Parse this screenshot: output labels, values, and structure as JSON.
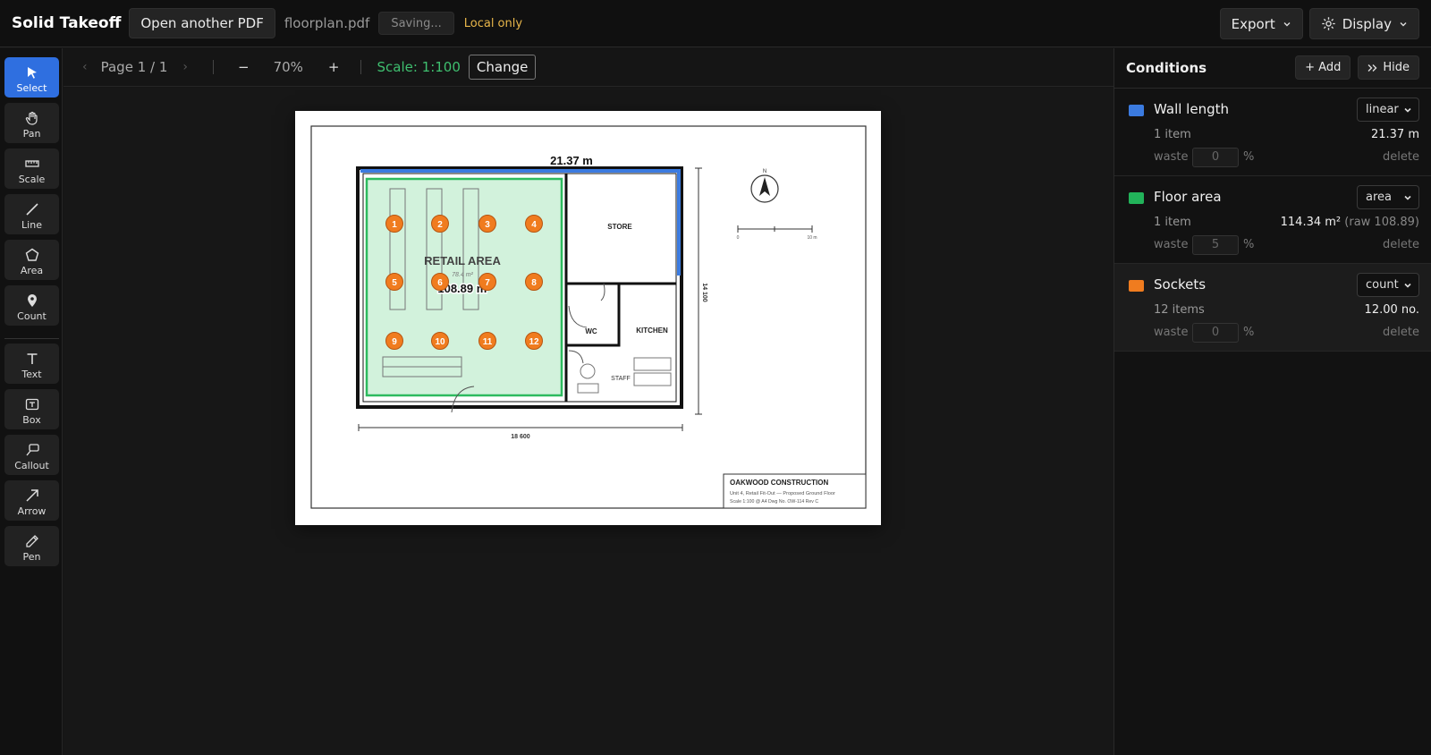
{
  "app": {
    "brand": "Solid Takeoff",
    "open_another": "Open another PDF",
    "filename": "floorplan.pdf",
    "saving": "Saving...",
    "local_only": "Local only",
    "export": "Export",
    "display": "Display"
  },
  "tools": [
    {
      "label": "Select",
      "icon": "cursor-icon",
      "active": true
    },
    {
      "label": "Pan",
      "icon": "hand-icon"
    },
    {
      "label": "Scale",
      "icon": "ruler-icon"
    },
    {
      "label": "Line",
      "icon": "line-icon"
    },
    {
      "label": "Area",
      "icon": "pentagon-icon"
    },
    {
      "label": "Count",
      "icon": "pin-icon"
    },
    {
      "label": "Text",
      "icon": "text-icon"
    },
    {
      "label": "Box",
      "icon": "textbox-icon"
    },
    {
      "label": "Callout",
      "icon": "callout-icon"
    },
    {
      "label": "Arrow",
      "icon": "arrow-icon"
    },
    {
      "label": "Pen",
      "icon": "pen-icon"
    }
  ],
  "viewbar": {
    "page": "Page 1 / 1",
    "zoom": "70%",
    "zoom_out": "−",
    "zoom_in": "+",
    "scale": "Scale: 1:100",
    "change": "Change"
  },
  "drawing": {
    "wall_measure": "21.37 m",
    "area_measure": "108.89 m²",
    "area_label": "RETAIL AREA",
    "area_sub": "78.4 m²",
    "rooms": [
      "STORE",
      "WC",
      "KITCHEN",
      "STAFF"
    ],
    "dim_bottom": "18 600",
    "dim_side": "14 100",
    "scale_bar": [
      "0",
      "10 m"
    ],
    "north": "N",
    "titleblock": {
      "company": "OAKWOOD CONSTRUCTION",
      "line1": "Unit 4, Retail Fit-Out — Proposed Ground Floor",
      "line2": "Scale 1:100 @ A4   Dwg No. OW-114   Rev C"
    },
    "counts": [
      "1",
      "2",
      "3",
      "4",
      "5",
      "6",
      "7",
      "8",
      "9",
      "10",
      "11",
      "12"
    ]
  },
  "conditions": {
    "title": "Conditions",
    "add": "+ Add",
    "hide": "Hide",
    "items": [
      {
        "name": "Wall length",
        "color": "#3b7be0",
        "type": "linear",
        "items": "1 item",
        "value": "21.37 m",
        "raw": "",
        "waste_label": "waste",
        "waste": "0",
        "pct": "%",
        "delete": "delete"
      },
      {
        "name": "Floor area",
        "color": "#22b35a",
        "type": "area",
        "items": "1 item",
        "value": "114.34 m²",
        "raw": "(raw 108.89)",
        "waste_label": "waste",
        "waste": "5",
        "pct": "%",
        "delete": "delete"
      },
      {
        "name": "Sockets",
        "color": "#f07c1f",
        "type": "count",
        "items": "12 items",
        "value": "12.00 no.",
        "raw": "",
        "waste_label": "waste",
        "waste": "0",
        "pct": "%",
        "delete": "delete"
      }
    ]
  }
}
